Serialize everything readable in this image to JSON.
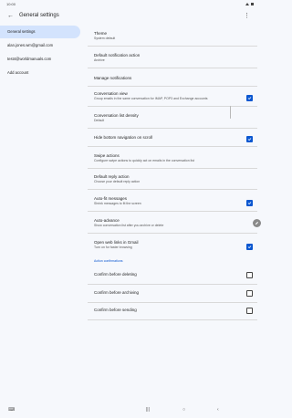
{
  "status_bar": {
    "time": "10:00",
    "right_icons": "wifi, battery"
  },
  "app_bar": {
    "title": "General settings",
    "back_icon": "arrow-back-icon",
    "more_icon": "more-vert-icon"
  },
  "sidebar": {
    "items": [
      {
        "label": "General settings",
        "active": true
      },
      {
        "label": "alan.jones.wm@gmail.com",
        "active": false
      },
      {
        "label": "test4@worldmanuals.com",
        "active": false
      },
      {
        "label": "Add account",
        "active": false
      }
    ]
  },
  "settings": {
    "theme": {
      "title": "Theme",
      "sub": "System default"
    },
    "default_notification": {
      "title": "Default notification action",
      "sub": "Archive"
    },
    "manage_notifications": {
      "title": "Manage notifications"
    },
    "conversation_view": {
      "title": "Conversation view",
      "sub": "Group emails in the same conversation for IMAP, POP3 and Exchange accounts",
      "checked": true
    },
    "list_density": {
      "title": "Conversation list density",
      "sub": "Default"
    },
    "hide_bottom_nav": {
      "title": "Hide bottom navigation on scroll",
      "checked": true
    },
    "swipe_actions": {
      "title": "Swipe actions",
      "sub": "Configure swipe actions to quickly act on emails in the conversation list"
    },
    "default_reply": {
      "title": "Default reply action",
      "sub": "Choose your default reply action"
    },
    "auto_fit": {
      "title": "Auto-fit messages",
      "sub": "Shrink messages to fit the screen",
      "checked": true
    },
    "auto_advance": {
      "title": "Auto-advance",
      "sub": "Show conversation list after you archive or delete"
    },
    "open_links": {
      "title": "Open web links in Gmail",
      "sub": "Turn on for faster browsing",
      "checked": true
    },
    "action_confirmations_header": "Action confirmations",
    "confirm_deleting": {
      "title": "Confirm before deleting",
      "checked": false
    },
    "confirm_archiving": {
      "title": "Confirm before archiving",
      "checked": false
    },
    "confirm_sending": {
      "title": "Confirm before sending",
      "checked": false
    }
  },
  "fab": {
    "icon": "edit-icon"
  },
  "nav_bar": {
    "icons": [
      "keyboard-icon",
      "recents-icon",
      "home-icon",
      "back-icon"
    ]
  },
  "colors": {
    "accent": "#0b57d0",
    "sidebar_active": "#d3e3fd",
    "background": "#f6f8fc"
  }
}
